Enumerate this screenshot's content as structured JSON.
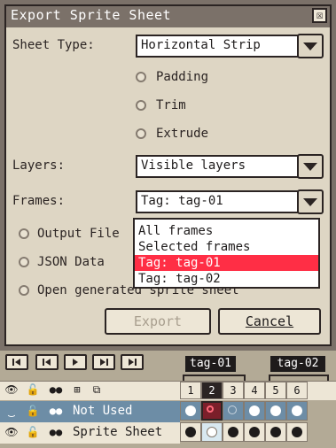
{
  "dialog": {
    "title": "Export Sprite Sheet",
    "close_glyph": "☒",
    "sheet_type_label": "Sheet Type:",
    "sheet_type_value": "Horizontal Strip",
    "padding_label": "Padding",
    "trim_label": "Trim",
    "extrude_label": "Extrude",
    "layers_label": "Layers:",
    "layers_value": "Visible layers",
    "frames_label": "Frames:",
    "frames_value": "Tag: tag-01",
    "output_file_label": "Output File",
    "json_data_label": "JSON Data",
    "open_generated_label": "Open generated sprite sheet",
    "export_button": "Export",
    "cancel_button": "Cancel"
  },
  "frames_dropdown": {
    "options": [
      "All frames",
      "Selected frames",
      "Tag: tag-01",
      "Tag: tag-02"
    ],
    "selected_index": 2
  },
  "timeline": {
    "tags": [
      "tag-01",
      "tag-02"
    ],
    "frame_numbers": [
      "1",
      "2",
      "3",
      "4",
      "5",
      "6"
    ],
    "layers": [
      {
        "name": "Not Used"
      },
      {
        "name": "Sprite Sheet"
      }
    ]
  },
  "colors": {
    "highlight": "#ff2e45",
    "dialog_bg": "#ded6c4",
    "title_bg": "#7b7169",
    "active_frame": "#7b1f2a"
  }
}
